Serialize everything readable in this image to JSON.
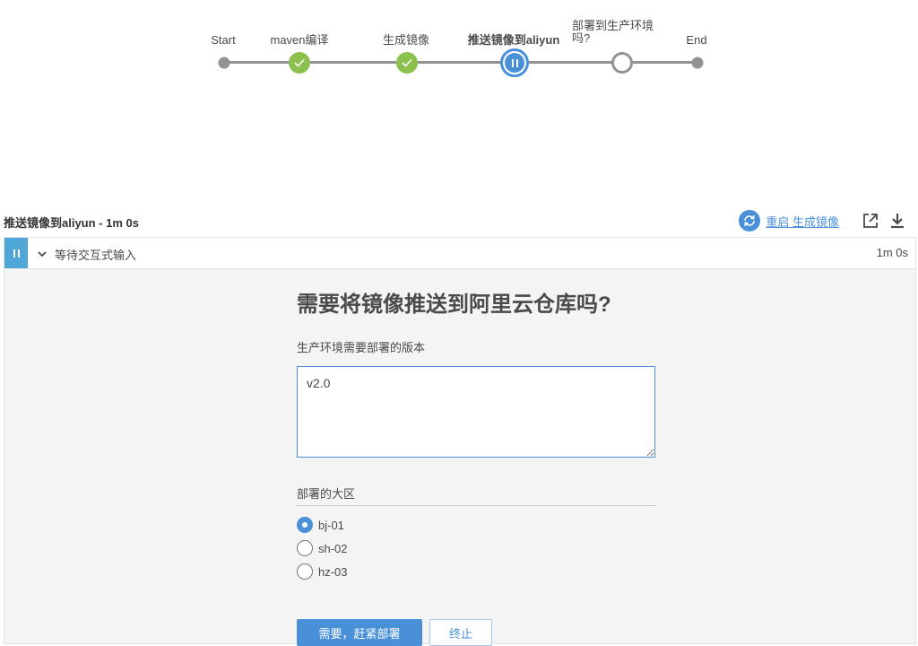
{
  "pipeline": {
    "stages": [
      {
        "label": "Start",
        "status": "start"
      },
      {
        "label": "maven编译",
        "status": "success"
      },
      {
        "label": "生成镜像",
        "status": "success"
      },
      {
        "label": "推送镜像到aliyun",
        "status": "paused",
        "selected": true
      },
      {
        "label": "部署到生产环境吗?",
        "status": "not-built"
      },
      {
        "label": "End",
        "status": "end"
      }
    ]
  },
  "step_header": {
    "title": "推送镜像到aliyun - 1m 0s",
    "restart_label": "重启 生成镜像",
    "icons": {
      "restart": "restart-icon",
      "open": "open-external-icon",
      "download": "download-icon"
    }
  },
  "log_row": {
    "label": "等待交互式输入",
    "time": "1m 0s"
  },
  "input_form": {
    "title": "需要将镜像推送到阿里云仓库吗?",
    "version_label": "生产环境需要部署的版本",
    "version_value": "v2.0",
    "region_label": "部署的大区",
    "regions": [
      {
        "label": "bj-01",
        "checked": true
      },
      {
        "label": "sh-02",
        "checked": false
      },
      {
        "label": "hz-03",
        "checked": false
      }
    ],
    "submit_label": "需要，赶紧部署",
    "abort_label": "终止"
  },
  "colors": {
    "success": "#8cc04f",
    "running": "#4a90d9",
    "paused_bar": "#4fa7d8",
    "line": "#949393"
  }
}
